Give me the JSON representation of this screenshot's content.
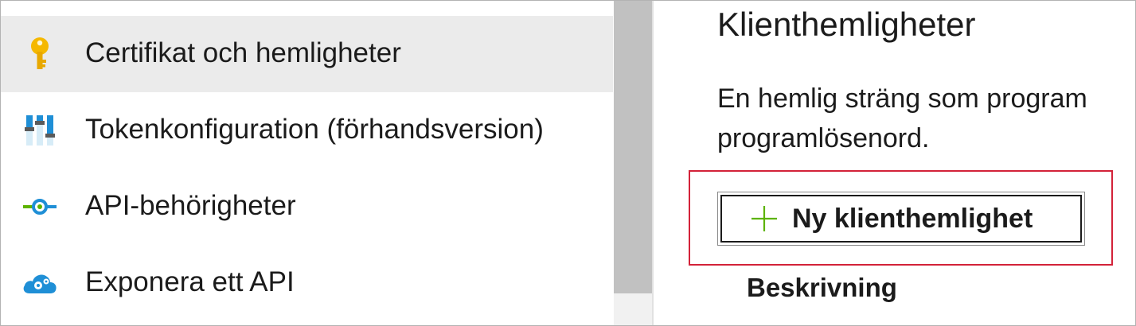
{
  "sidebar": {
    "items": [
      {
        "label": "Certifikat och hemligheter",
        "icon": "key-icon",
        "selected": true
      },
      {
        "label": "Tokenkonfiguration (förhandsversion)",
        "icon": "sliders-icon",
        "selected": false
      },
      {
        "label": "API-behörigheter",
        "icon": "api-permissions-icon",
        "selected": false
      },
      {
        "label": "Exponera ett API",
        "icon": "cloud-gear-icon",
        "selected": false
      }
    ]
  },
  "main": {
    "title": "Klienthemligheter",
    "description_line1": "En hemlig sträng som program",
    "description_line2": "programlösenord.",
    "new_secret_button": {
      "icon": "plus-icon",
      "label": "Ny klienthemlighet"
    },
    "table": {
      "columns": [
        "Beskrivning"
      ]
    }
  },
  "colors": {
    "selected_bg": "#ebebeb",
    "highlight_border": "#d32239",
    "plus_green": "#5db300",
    "key_yellow": "#f5b800",
    "link_blue": "#1f8fd6"
  }
}
